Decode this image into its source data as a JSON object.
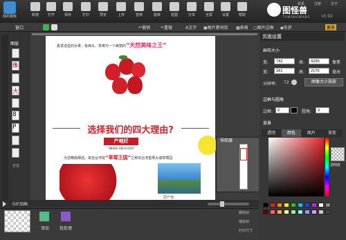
{
  "toolbar": {
    "logo_label": "我的模板",
    "items": [
      "新建",
      "打开",
      "保存",
      "打印",
      "预览",
      "上传",
      "替换",
      "旋转",
      "抠图",
      "分享",
      "全屏",
      "设置",
      "帮助"
    ],
    "links": [
      "联系",
      "注册",
      "关于"
    ]
  },
  "brand": {
    "name": "图怪兽",
    "pinyin": "TUWANGWANG",
    "version": "v5.92"
  },
  "toolbar2": {
    "left": "窗口",
    "labels": [
      "撤销",
      "重做",
      "文字",
      "图片素材库",
      "表格",
      "图片边框",
      "形状",
      "更多"
    ]
  },
  "layers": {
    "title": "图层",
    "all": "全选"
  },
  "page": {
    "intro": "夏季造型的水果，有西瓜、草莓与一个美丽的",
    "intro_highlight": "“天然美味之王”",
    "headline": "选择我们的四大理由?",
    "badge": "产地好",
    "badge_sub": "SNAKE DELICIOUS",
    "body": "为您精挑细选，来自台湾有",
    "body_highlight": "“草莓王国”",
    "body_tail": "之称的台湾苗栗大湖草莓园",
    "caption": "原产地"
  },
  "navigator": {
    "title": "导航器"
  },
  "gif": {
    "title": "GIF动画",
    "btn_add": "添加",
    "btn_batch": "批处理",
    "right_items": [
      "删除帧",
      "播放帧",
      "打印尺寸"
    ]
  },
  "right": {
    "panel_title": "页面设置",
    "canvas_size": "画布大小",
    "w_label": "宽:",
    "w_value": "742",
    "h_label": "高:",
    "h_value": "4200",
    "unit_px": "像素",
    "w2_value": "261",
    "h2_value": "2170",
    "unit_mm": "毫米",
    "res_label": "分辨率:",
    "res_value": "72",
    "bigbtn": "图像大小指放",
    "border_title": "边框与圆角",
    "border_label": "边框:",
    "border_value": "0",
    "radius_label": "圆角:",
    "radius_value": "0",
    "bg_title": "背景",
    "tabs": [
      "透明",
      "颜色",
      "图片",
      "渐变"
    ],
    "transparent_label": "透明度"
  }
}
